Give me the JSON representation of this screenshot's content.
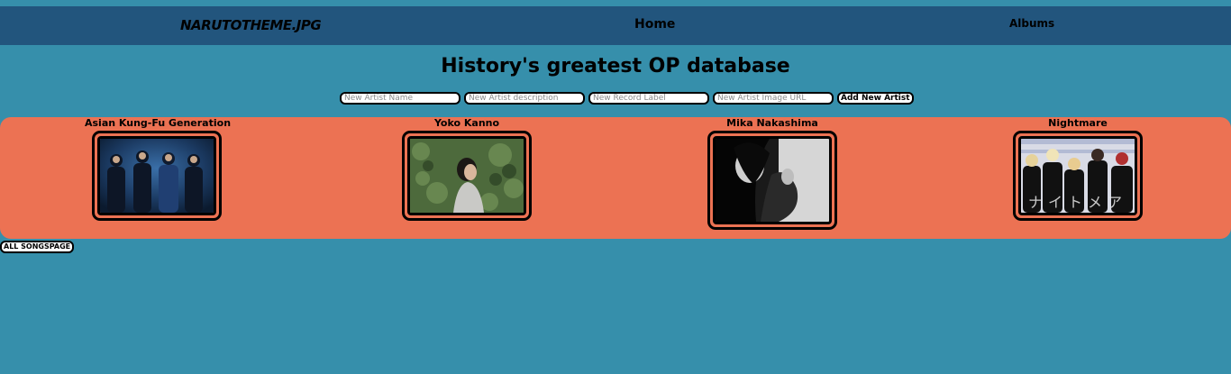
{
  "nav": {
    "brand": "NARUTOTHEME.JPG",
    "home": "Home",
    "albums": "Albums"
  },
  "page_title": "History's greatest OP database",
  "form": {
    "artist_name_placeholder": "New Artist Name",
    "artist_description_placeholder": "New Artist description",
    "record_label_placeholder": "New Record Label",
    "image_url_placeholder": "New Artist Image URL",
    "submit_label": "Add New Artist"
  },
  "artists": [
    {
      "name": "Asian Kung-Fu Generation",
      "photo": "band-photo-dark-blue"
    },
    {
      "name": "Yoko Kanno",
      "photo": "portrait-green-foliage"
    },
    {
      "name": "Mika Nakashima",
      "photo": "portrait-black-and-white"
    },
    {
      "name": "Nightmare",
      "photo": "band-photo-with-katakana"
    }
  ],
  "nightmare_katakana": "ナイトメア",
  "all_songs_label": "ALL SONGSPAGE",
  "colors": {
    "background": "#368fab",
    "navbar": "#22557d",
    "artist_panel": "#ec7253"
  }
}
